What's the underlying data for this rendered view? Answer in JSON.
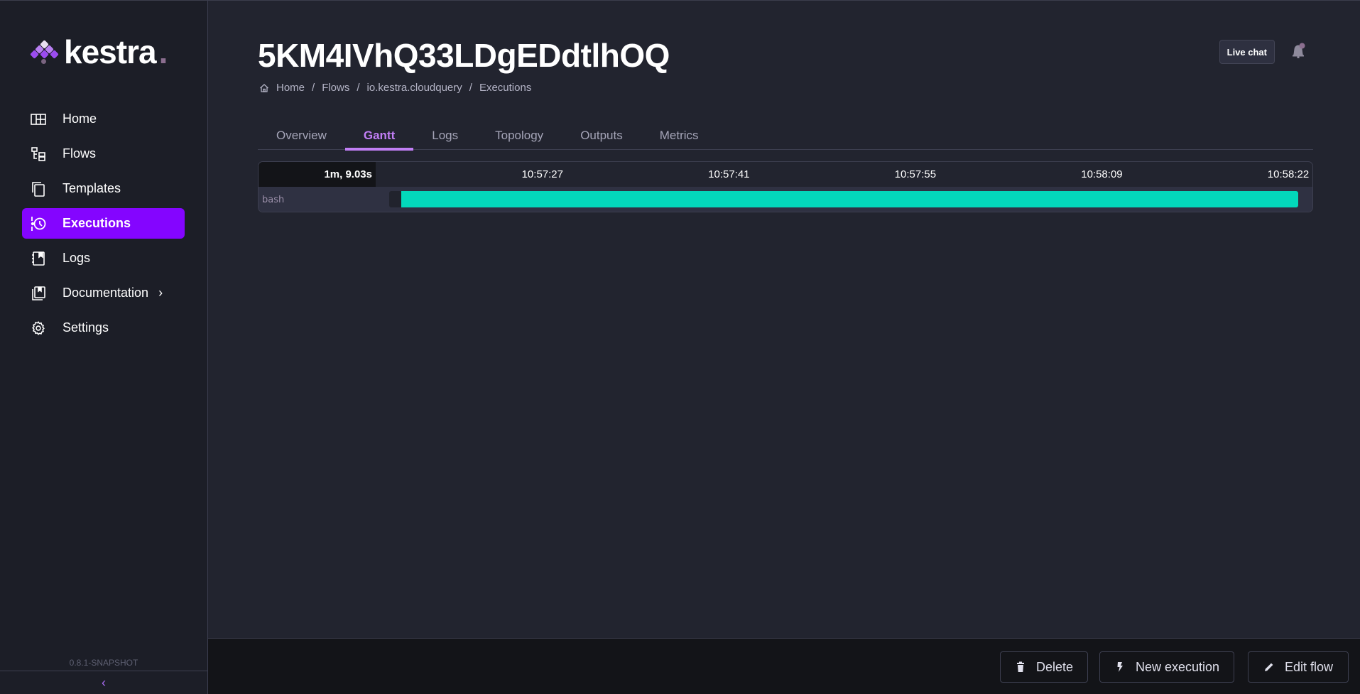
{
  "sidebar": {
    "logo_text": "kestra",
    "logo_dot": ".",
    "items": [
      {
        "label": "Home",
        "icon": "home-grid-icon",
        "active": false
      },
      {
        "label": "Flows",
        "icon": "flows-icon",
        "active": false
      },
      {
        "label": "Templates",
        "icon": "templates-icon",
        "active": false
      },
      {
        "label": "Executions",
        "icon": "executions-icon",
        "active": true
      },
      {
        "label": "Logs",
        "icon": "logs-icon",
        "active": false
      },
      {
        "label": "Documentation",
        "icon": "documentation-icon",
        "active": false,
        "has_submenu": true
      },
      {
        "label": "Settings",
        "icon": "gear-icon",
        "active": false
      }
    ],
    "version": "0.8.1-SNAPSHOT",
    "collapse_icon": "‹"
  },
  "header": {
    "title": "5KM4IVhQ33LDgEDdtlhOQ",
    "breadcrumb": [
      "Home",
      "Flows",
      "io.kestra.cloudquery",
      "Executions"
    ],
    "breadcrumb_sep": "/",
    "live_chat_label": "Live chat",
    "notification_icon": "bell-icon"
  },
  "tabs": [
    {
      "label": "Overview",
      "active": false
    },
    {
      "label": "Gantt",
      "active": true
    },
    {
      "label": "Logs",
      "active": false
    },
    {
      "label": "Topology",
      "active": false
    },
    {
      "label": "Outputs",
      "active": false
    },
    {
      "label": "Metrics",
      "active": false
    }
  ],
  "gantt": {
    "total_duration": "1m, 9.03s",
    "ticks": [
      "10:57:27",
      "10:57:41",
      "10:57:55",
      "10:58:09",
      "10:58:22"
    ],
    "tasks": [
      {
        "name": "bash",
        "start_fraction": 0.013,
        "end_fraction": 1.0,
        "state_color": "#03d8bb"
      }
    ]
  },
  "footer": {
    "delete_label": "Delete",
    "new_execution_label": "New execution",
    "edit_flow_label": "Edit flow"
  },
  "colors": {
    "accent": "#8405ff",
    "tab_active": "#c17ef5",
    "success": "#03d8bb"
  }
}
